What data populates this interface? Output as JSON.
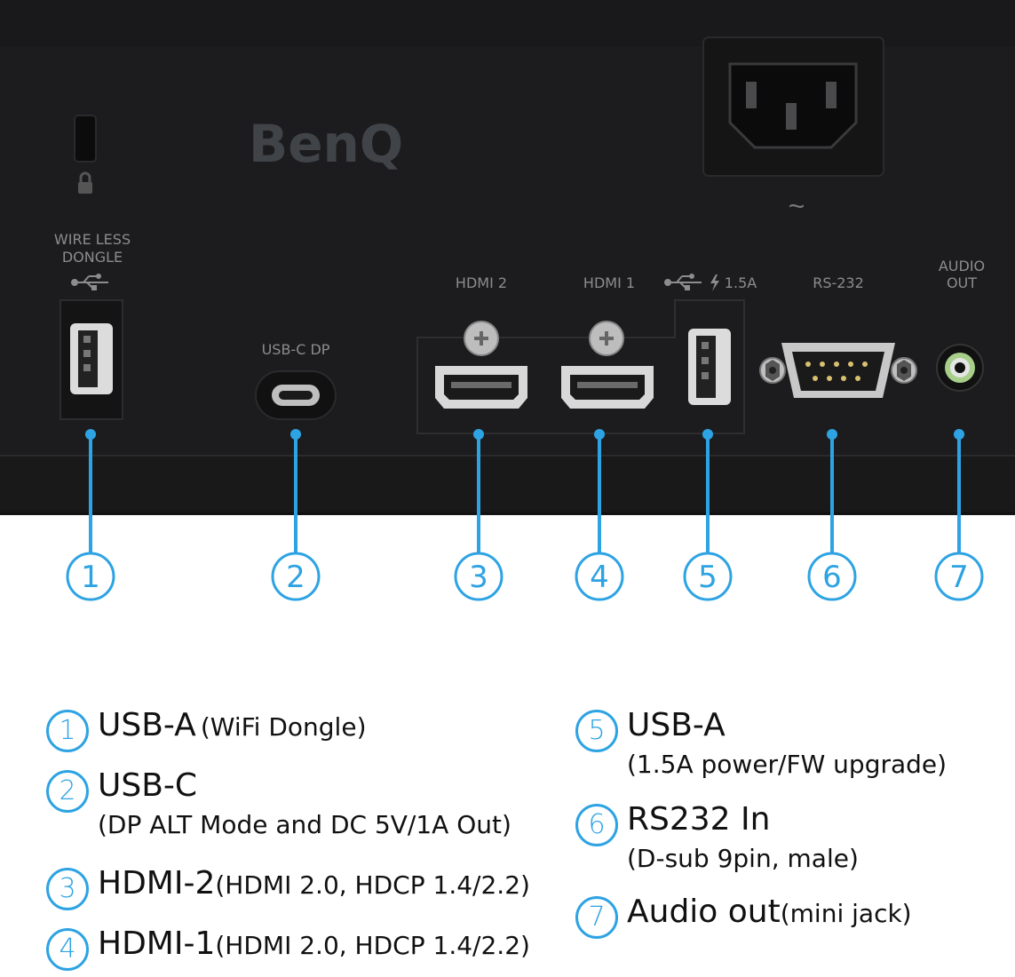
{
  "brand": {
    "logo_text": "BenQ"
  },
  "panel_labels": {
    "wireless_dongle": [
      "WIRE LESS",
      "DONGLE"
    ],
    "usbc": "USB-C DP",
    "hdmi2": "HDMI 2",
    "hdmi1": "HDMI 1",
    "usb_power": "1.5A",
    "rs232": "RS-232",
    "audio_out": [
      "AUDIO",
      "OUT"
    ],
    "power_symbol": "~"
  },
  "callout_numbers": [
    "1",
    "2",
    "3",
    "4",
    "5",
    "6",
    "7"
  ],
  "legend": [
    {
      "num": "1",
      "title": "USB-A",
      "detail": "(WiFi Dongle)"
    },
    {
      "num": "2",
      "title": "USB-C",
      "detail": "(DP ALT Mode and DC 5V/1A Out)"
    },
    {
      "num": "3",
      "title": "HDMI-2",
      "detail": "(HDMI 2.0, HDCP 1.4/2.2)"
    },
    {
      "num": "4",
      "title": "HDMI-1",
      "detail": "(HDMI 2.0, HDCP 1.4/2.2)"
    },
    {
      "num": "5",
      "title": "USB-A",
      "detail": "(1.5A power/FW upgrade)"
    },
    {
      "num": "6",
      "title": "RS232 In",
      "detail": "(D-sub 9pin, male)"
    },
    {
      "num": "7",
      "title": "Audio out",
      "detail": "(mini jack)"
    }
  ],
  "colors": {
    "accent": "#2ea3e3",
    "panel": "#1c1c1e",
    "port_label": "#8c8c8c"
  }
}
